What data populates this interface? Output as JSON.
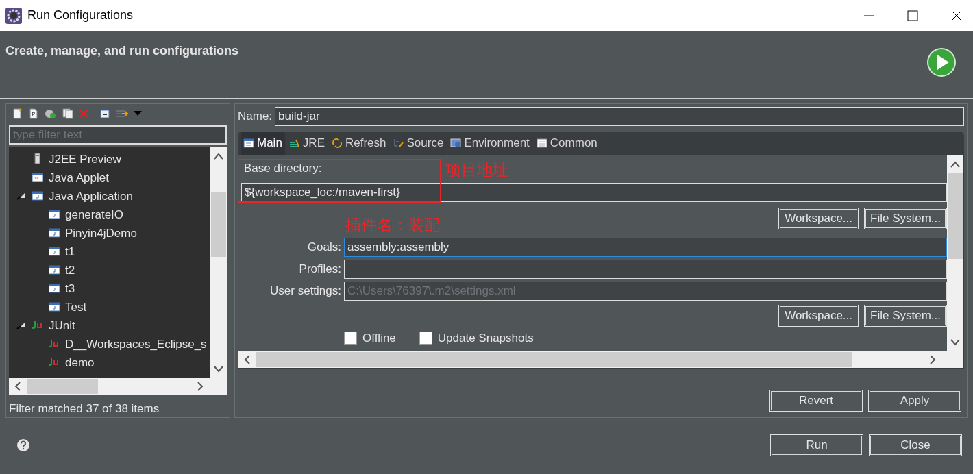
{
  "window": {
    "title": "Run Configurations"
  },
  "header": {
    "title": "Create, manage, and run configurations"
  },
  "sidebar": {
    "filter": {
      "placeholder": "type filter text"
    },
    "tree": [
      {
        "label": "J2EE Preview",
        "kind": "j2ee"
      },
      {
        "label": "Java Applet",
        "kind": "applet"
      },
      {
        "label": "Java Application",
        "kind": "java",
        "expanded": true,
        "children": [
          {
            "label": "generateIO",
            "kind": "java"
          },
          {
            "label": "Pinyin4jDemo",
            "kind": "java"
          },
          {
            "label": "t1",
            "kind": "java"
          },
          {
            "label": "t2",
            "kind": "java"
          },
          {
            "label": "t3",
            "kind": "java"
          },
          {
            "label": "Test",
            "kind": "java"
          }
        ]
      },
      {
        "label": "JUnit",
        "kind": "junit",
        "expanded": true,
        "children": [
          {
            "label": "D__Workspaces_Eclipse_s",
            "kind": "junit"
          },
          {
            "label": "demo",
            "kind": "junit"
          }
        ]
      }
    ],
    "status": "Filter matched 37 of 38 items"
  },
  "name": {
    "label": "Name:",
    "value": "build-jar"
  },
  "tabs": [
    {
      "label": "Main",
      "kind": "main",
      "selected": true
    },
    {
      "label": "JRE",
      "kind": "jre",
      "selected": false
    },
    {
      "label": "Refresh",
      "kind": "refresh",
      "selected": false
    },
    {
      "label": "Source",
      "kind": "source",
      "selected": false
    },
    {
      "label": "Environment",
      "kind": "environment",
      "selected": false
    },
    {
      "label": "Common",
      "kind": "common",
      "selected": false
    }
  ],
  "main_tab": {
    "base_directory": {
      "label": "Base directory:",
      "value": "${workspace_loc:/maven-first}"
    },
    "buttons_1": [
      "Workspace...",
      "File System..."
    ],
    "fields": [
      {
        "label": "Goals:",
        "value": "assembly:assembly",
        "focused": true
      },
      {
        "label": "Profiles:",
        "focused": false
      },
      {
        "label": "User settings:",
        "placeholder": "C:\\Users\\76397\\.m2\\settings.xml",
        "focused": false
      }
    ],
    "buttons_2": [
      "Workspace...",
      "File System..."
    ],
    "checkboxes": [
      {
        "label": "Offline",
        "checked": false
      },
      {
        "label": "Update Snapshots",
        "checked": false
      }
    ]
  },
  "annotations": [
    {
      "text": "项目地址"
    },
    {
      "text": "插件名：装配"
    }
  ],
  "actions": [
    "Revert",
    "Apply"
  ],
  "footer_buttons": [
    "Run",
    "Close"
  ]
}
